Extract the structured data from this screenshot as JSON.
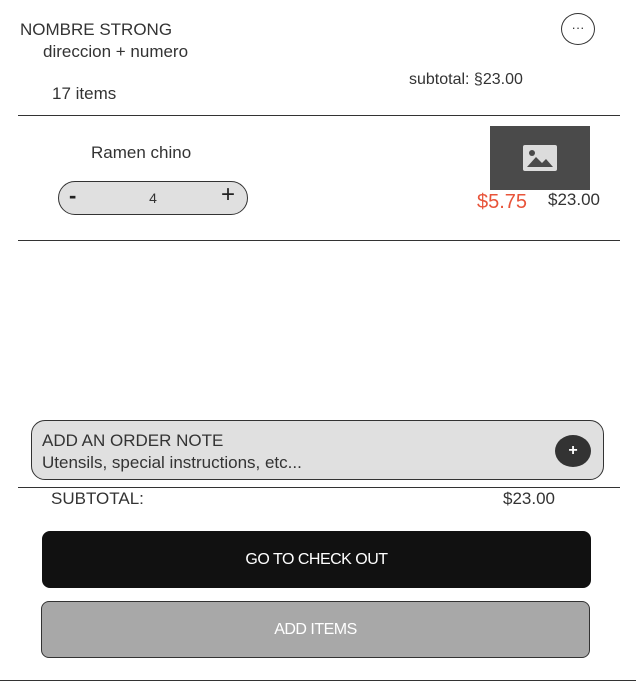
{
  "store": {
    "name": "NOMBRE STRONG",
    "address": "direccion + numero",
    "more_icon": "ellipsis-icon",
    "more_label": "···"
  },
  "cart": {
    "item_count": "17 items",
    "subtotal": "subtotal: §23.00"
  },
  "items": [
    {
      "name": "Ramen chino",
      "quantity": "4",
      "decrement": "-",
      "increment": "+",
      "unit_price": "$5.75",
      "line_total": "$23.00",
      "image_icon": "image-placeholder-icon"
    }
  ],
  "note": {
    "title": "ADD AN ORDER NOTE",
    "subtitle": "Utensils, special instructions, etc...",
    "add_icon": "plus-icon",
    "add_label": "+"
  },
  "summary": {
    "label": "SUBTOTAL:",
    "value": "$23.00"
  },
  "buttons": {
    "checkout": "GO TO CHECK OUT",
    "add_items": "ADD ITEMS"
  },
  "colors": {
    "accent_price": "#e8543a",
    "primary_button": "#111111",
    "secondary_button": "#a8a8a8"
  }
}
